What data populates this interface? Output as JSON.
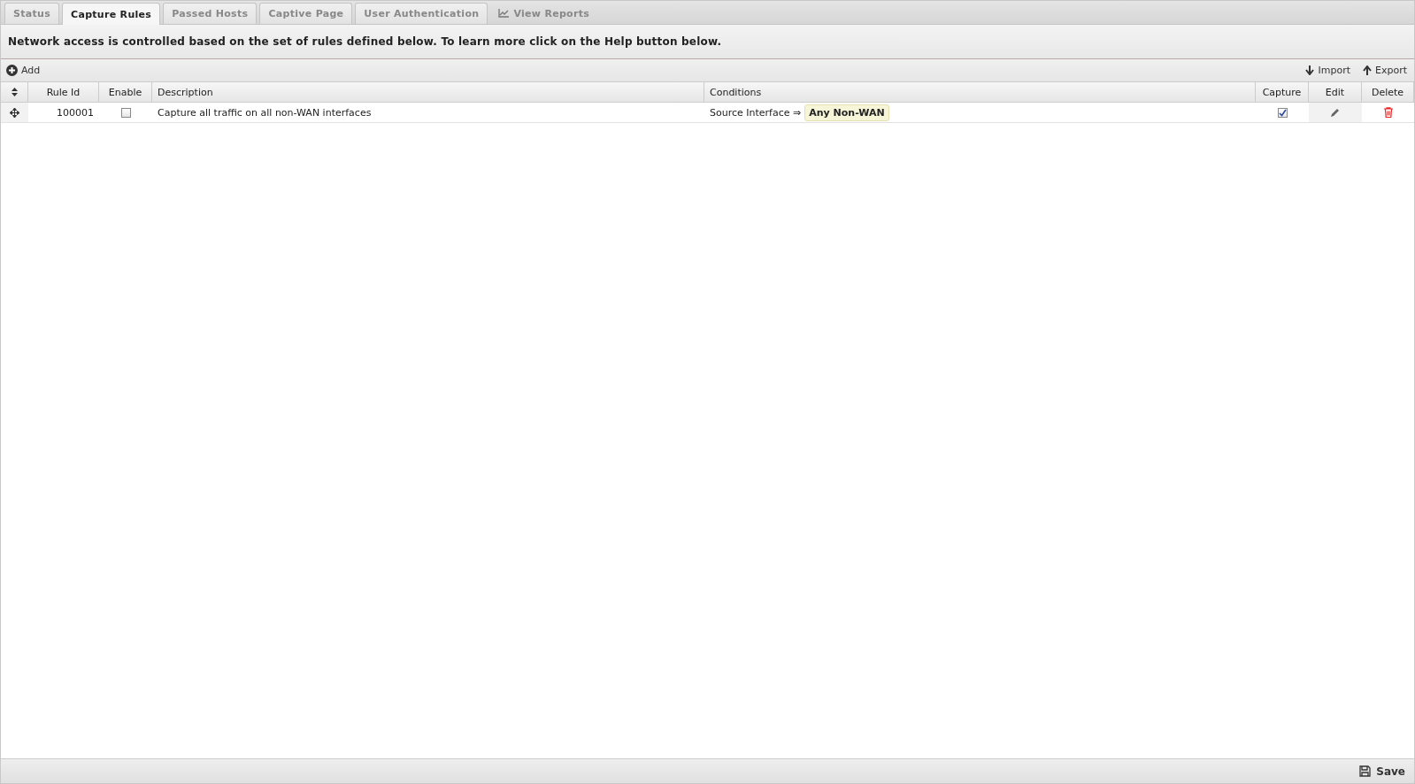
{
  "tabs": [
    {
      "label": "Status",
      "selected": false,
      "kind": "plain"
    },
    {
      "label": "Capture Rules",
      "selected": true,
      "kind": "plain"
    },
    {
      "label": "Passed Hosts",
      "selected": false,
      "kind": "plain"
    },
    {
      "label": "Captive Page",
      "selected": false,
      "kind": "plain"
    },
    {
      "label": "User Authentication",
      "selected": false,
      "kind": "plain"
    },
    {
      "label": "View Reports",
      "selected": false,
      "kind": "reports"
    }
  ],
  "info": "Network access is controlled based on the set of rules defined below. To learn more click on the Help button below.",
  "toolbar": {
    "add": "Add",
    "import": "Import",
    "export": "Export"
  },
  "table": {
    "columns": [
      "Rule Id",
      "Enable",
      "Description",
      "Conditions",
      "Capture",
      "Edit",
      "Delete"
    ],
    "rows": [
      {
        "rule_id": "100001",
        "enabled": false,
        "description": "Capture all traffic on all non-WAN interfaces",
        "condition_label": "Source Interface ⇒",
        "condition_value": "Any Non-WAN",
        "capture": true
      }
    ]
  },
  "footer": {
    "save": "Save"
  }
}
